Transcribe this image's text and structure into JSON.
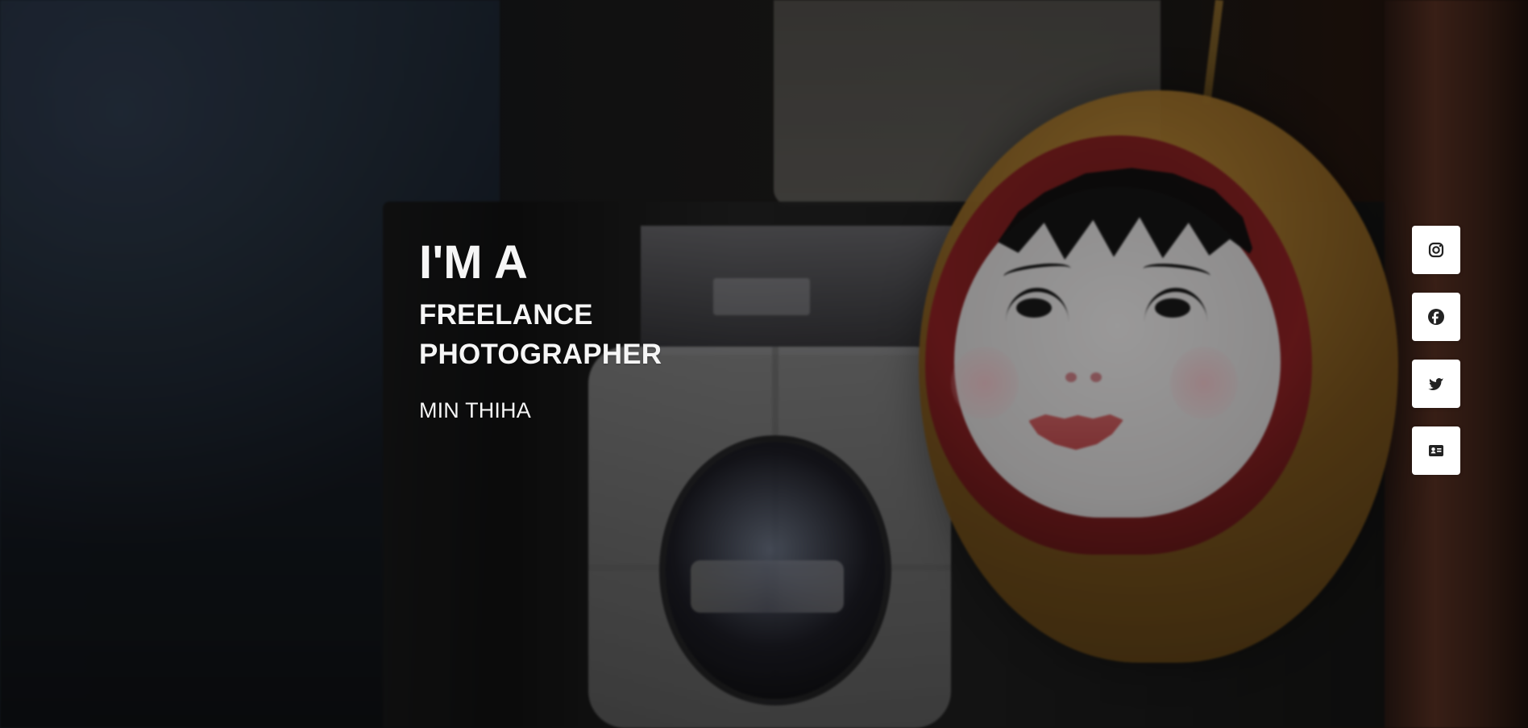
{
  "hero": {
    "intro": "I'M A",
    "role_line_1": "FREELANCE",
    "role_line_2": "PHOTOGRAPHER",
    "name": "MIN THIHA"
  },
  "social_links": [
    {
      "name": "instagram",
      "icon": "instagram-icon"
    },
    {
      "name": "facebook",
      "icon": "facebook-icon"
    },
    {
      "name": "twitter",
      "icon": "twitter-icon"
    },
    {
      "name": "contact-card",
      "icon": "contact-card-icon"
    }
  ],
  "colors": {
    "text": "#f6f6f6",
    "button_bg": "#ffffff",
    "icon": "#222222",
    "overlay": "#00000057"
  }
}
